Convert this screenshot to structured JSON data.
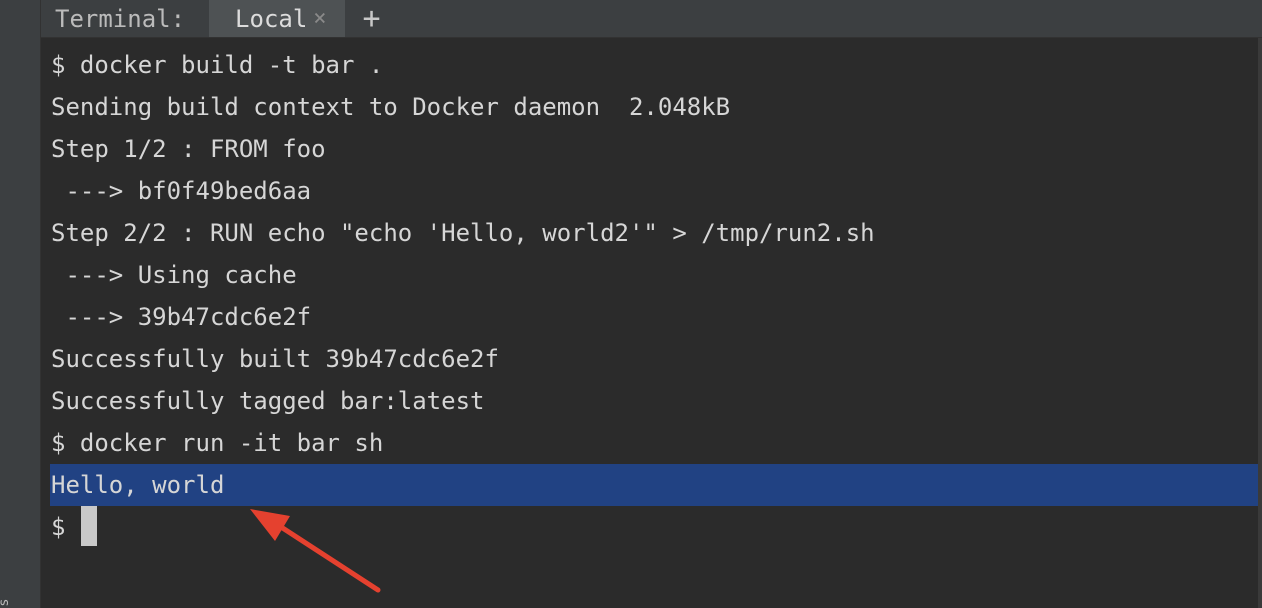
{
  "sidebar": {
    "label": "s"
  },
  "tabbar": {
    "title": "Terminal:",
    "tabs": [
      {
        "label": "Local",
        "close": "×"
      }
    ],
    "add": "+"
  },
  "terminal": {
    "lines": [
      "$ docker build -t bar .",
      "Sending build context to Docker daemon  2.048kB",
      "Step 1/2 : FROM foo",
      " ---> bf0f49bed6aa",
      "Step 2/2 : RUN echo \"echo 'Hello, world2'\" > /tmp/run2.sh",
      " ---> Using cache",
      " ---> 39b47cdc6e2f",
      "Successfully built 39b47cdc6e2f",
      "Successfully tagged bar:latest",
      "$ docker run -it bar sh",
      "Hello, world"
    ],
    "prompt": "$"
  },
  "colors": {
    "selection": "#214283",
    "annotation_arrow": "#e5412f"
  }
}
